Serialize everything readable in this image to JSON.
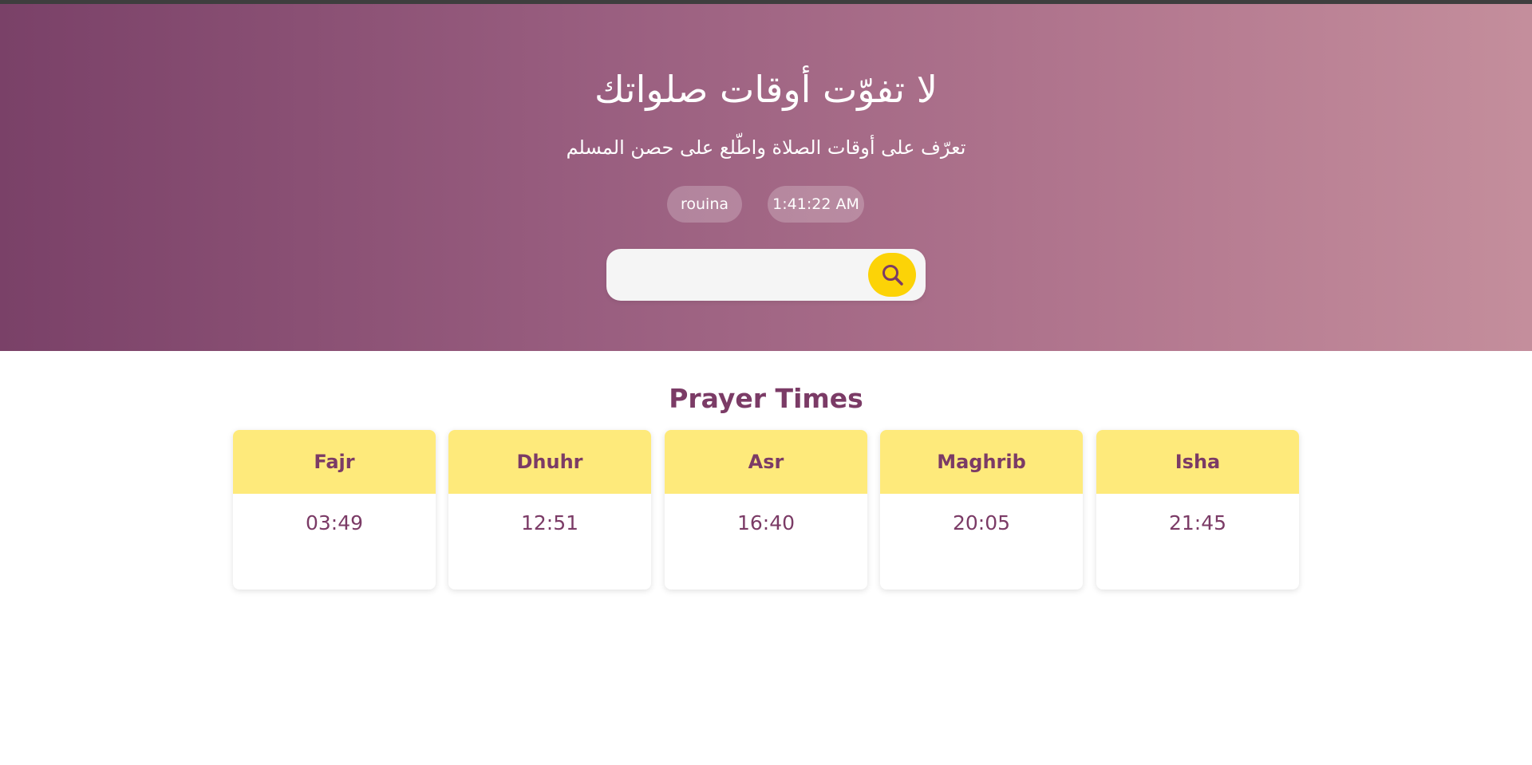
{
  "hero": {
    "title": "لا تفوّت أوقات صلواتك",
    "subtitle": "تعرّف على أوقات الصلاة واطّلع على حصن المسلم",
    "location": "rouina",
    "clock": "1:41:22 AM",
    "search_placeholder": ""
  },
  "prayers": {
    "title": "Prayer Times",
    "items": [
      {
        "name": "Fajr",
        "time": "03:49"
      },
      {
        "name": "Dhuhr",
        "time": "12:51"
      },
      {
        "name": "Asr",
        "time": "16:40"
      },
      {
        "name": "Maghrib",
        "time": "20:05"
      },
      {
        "name": "Isha",
        "time": "21:45"
      }
    ]
  },
  "colors": {
    "gradient_start": "#7a4168",
    "gradient_end": "#c48e9c",
    "accent_yellow": "#fcd307",
    "card_header": "#feea7b",
    "text_purple": "#7b3b66"
  },
  "icons": {
    "search": "search-icon"
  }
}
